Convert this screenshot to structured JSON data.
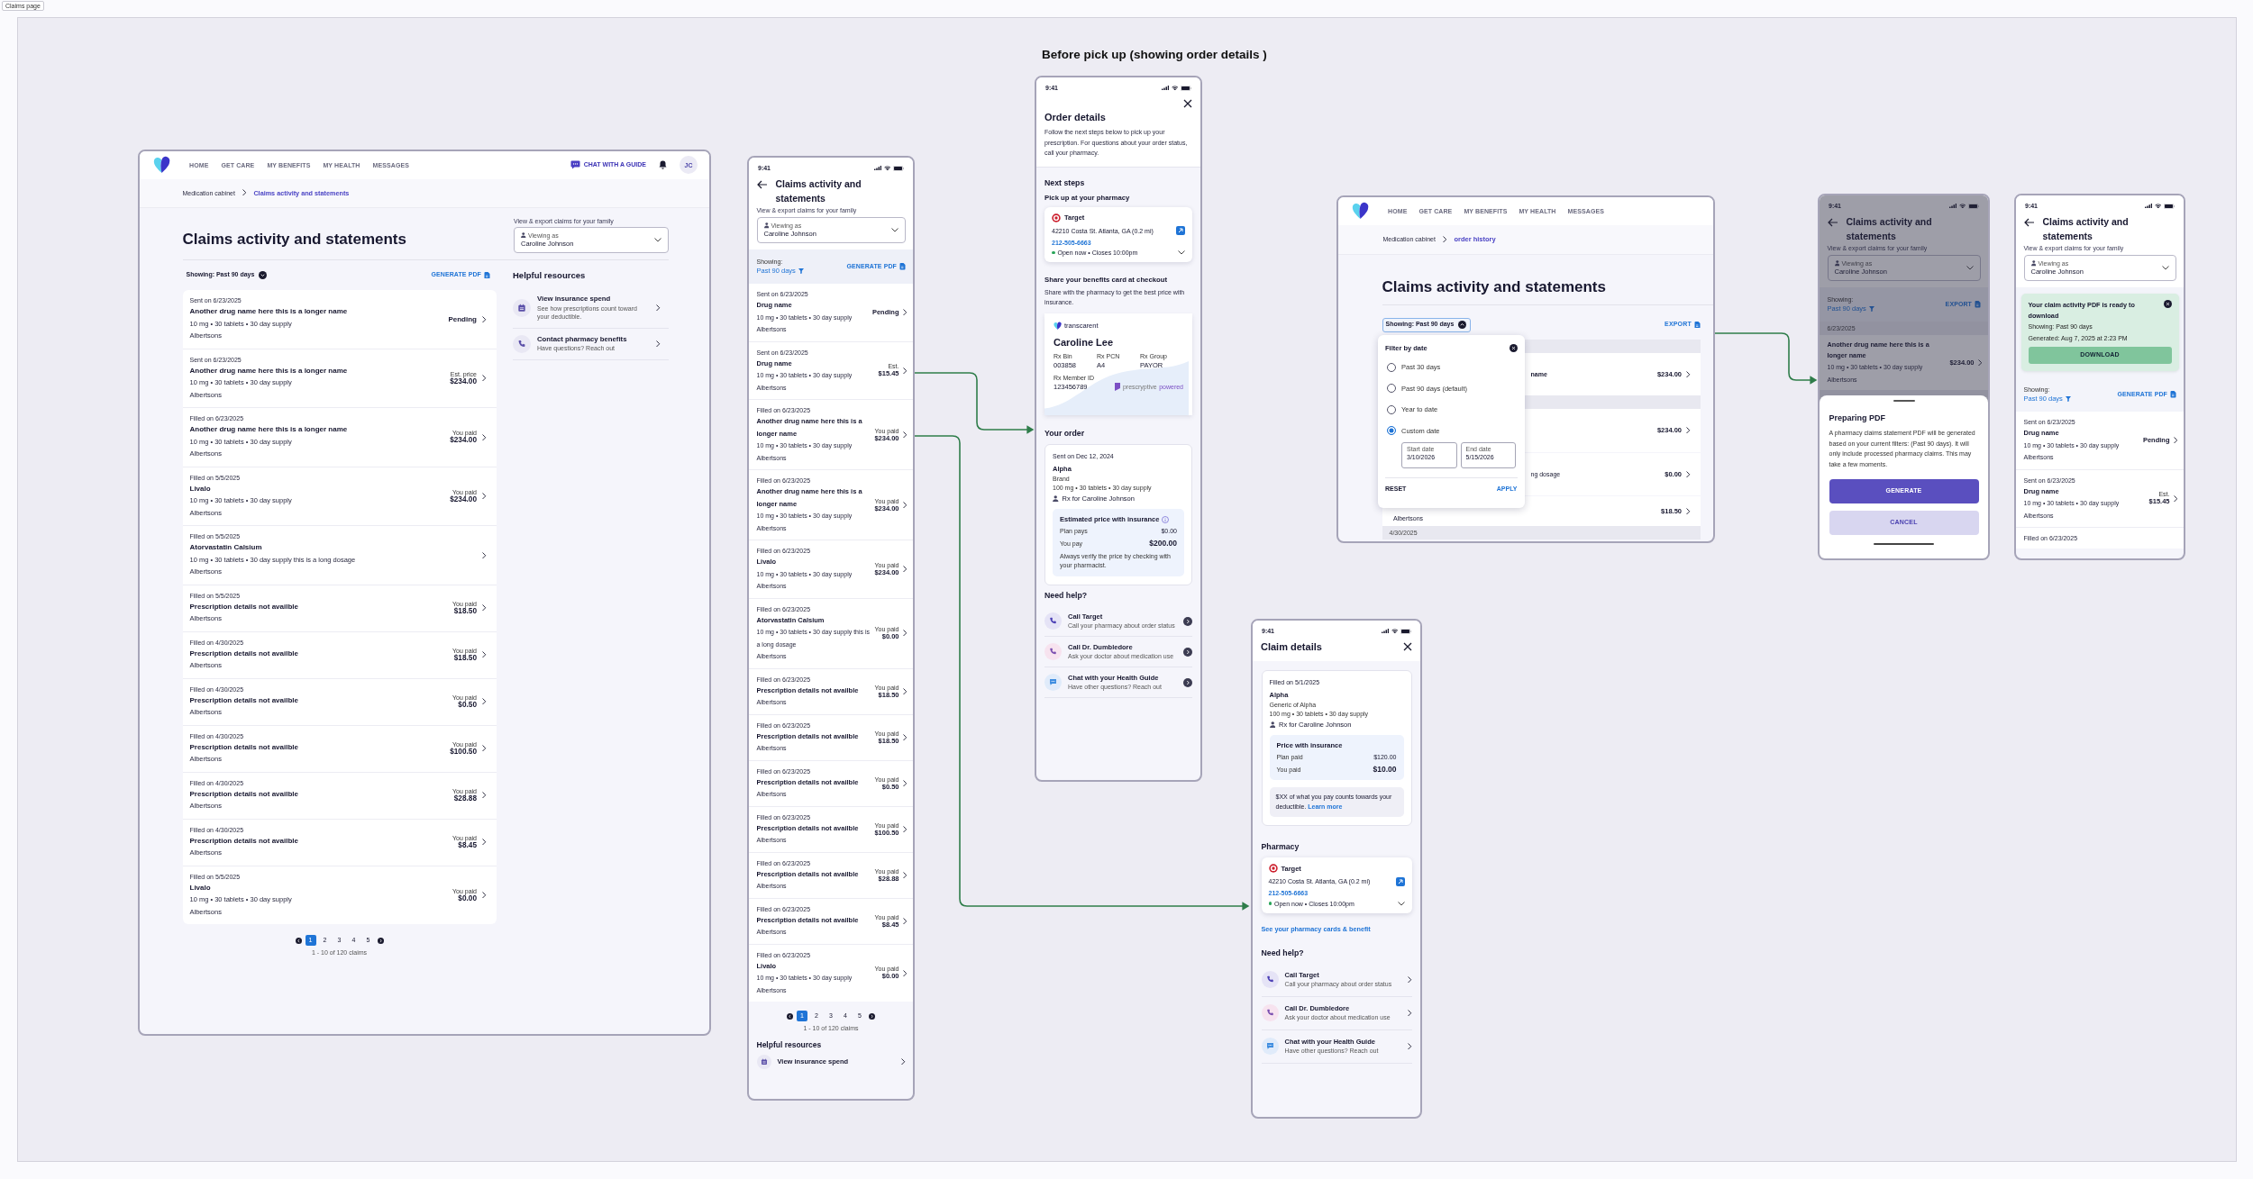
{
  "canvas": {
    "page_tag": "Claims page",
    "section_title": "Before pick up (showing order details )"
  },
  "desktop_claims": {
    "nav": {
      "items": [
        "HOME",
        "GET CARE",
        "MY BENEFITS",
        "MY HEALTH",
        "MESSAGES"
      ],
      "chat": "CHAT WITH A GUIDE",
      "avatar": "JC"
    },
    "breadcrumb": [
      "Medication cabinet",
      "Claims activity and statements"
    ],
    "title": "Claims activity and statements",
    "family_label": "View & export claims for your family",
    "viewer": {
      "label": "Viewing as",
      "name": "Caroline Johnson"
    },
    "filter": {
      "label": "Showing: Past 90 days"
    },
    "generate": "GENERATE PDF",
    "claims": [
      {
        "date": "Sent on 6/23/2025",
        "name": "Another drug name here this is a longer name",
        "detail": "10 mg • 30 tablets • 30 day supply",
        "pharmacy": "Albertsons",
        "status": "Pending"
      },
      {
        "date": "Sent on 6/23/2025",
        "name": "Another drug name here this is a longer name",
        "detail": "10 mg • 30 tablets • 30 day supply",
        "pharmacy": "Albertsons",
        "price_label": "Est. price",
        "amount": "$234.00"
      },
      {
        "date": "Filled on 6/23/2025",
        "name": "Another drug name here this is a longer name",
        "detail": "10 mg • 30 tablets • 30 day supply",
        "pharmacy": "Albertsons",
        "price_label": "You paid",
        "amount": "$234.00"
      },
      {
        "date": "Filled on 5/5/2025",
        "name": "Livalo",
        "detail": "10 mg • 30 tablets • 30 day supply",
        "pharmacy": "Albertsons",
        "price_label": "You paid",
        "amount": "$234.00"
      },
      {
        "date": "Filled on 5/5/2025",
        "name": "Atorvastatin Calsium",
        "detail": "10 mg • 30 tablets • 30 day supply this is a long dosage",
        "pharmacy": "Albertsons"
      },
      {
        "date": "Filled on 5/5/2025",
        "name": "Prescription details not availble",
        "pharmacy": "Albertsons",
        "price_label": "You paid",
        "amount": "$18.50"
      },
      {
        "date": "Filled on 4/30/2025",
        "name": "Prescription details not availble",
        "pharmacy": "Albertsons",
        "price_label": "You paid",
        "amount": "$18.50"
      },
      {
        "date": "Filled on 4/30/2025",
        "name": "Prescription details not availble",
        "pharmacy": "Albertsons",
        "price_label": "You paid",
        "amount": "$0.50"
      },
      {
        "date": "Filled on 4/30/2025",
        "name": "Prescription details not availble",
        "pharmacy": "Albertsons",
        "price_label": "You paid",
        "amount": "$100.50"
      },
      {
        "date": "Filled on 4/30/2025",
        "name": "Prescription details not availble",
        "pharmacy": "Albertsons",
        "price_label": "You paid",
        "amount": "$28.88"
      },
      {
        "date": "Filled on 4/30/2025",
        "name": "Prescription details not availble",
        "pharmacy": "Albertsons",
        "price_label": "You paid",
        "amount": "$8.45"
      },
      {
        "date": "Filled on 5/5/2025",
        "name": "Livalo",
        "detail": "10 mg • 30 tablets • 30 day supply",
        "pharmacy": "Albertsons",
        "price_label": "You paid",
        "amount": "$0.00"
      }
    ],
    "pagination": {
      "pages": [
        {
          "label": "1",
          "selected": true
        },
        {
          "label": "2",
          "selected": false
        },
        {
          "label": "3",
          "selected": false
        },
        {
          "label": "4",
          "selected": false
        },
        {
          "label": "5",
          "selected": false
        }
      ],
      "summary": "1 - 10 of 120 claims"
    },
    "resources": {
      "title": "Helpful resources",
      "items": [
        {
          "kind": "calendar",
          "title": "View insurance spend",
          "subtitle": "See how prescriptions count toward your deductible."
        },
        {
          "kind": "phone",
          "title": "Contact pharmacy benefits",
          "subtitle": "Have questions? Reach out"
        }
      ]
    }
  },
  "mobile_claims": {
    "time": "9:41",
    "title": "Claims activity and statements",
    "family_label": "View & export claims for your family",
    "viewer": {
      "label": "Viewing as",
      "name": "Caroline Johnson"
    },
    "showing_label": "Showing:",
    "filter_value": "Past 90 days",
    "generate": "GENERATE PDF",
    "claims": [
      {
        "date": "Sent on 6/23/2025",
        "name": "Drug name",
        "detail": "10 mg • 30 tablets • 30 day supply",
        "pharmacy": "Albertsons",
        "status": "Pending"
      },
      {
        "date": "Sent on 6/23/2025",
        "name": "Drug name",
        "detail": "10 mg • 30 tablets • 30 day supply",
        "pharmacy": "Albertsons",
        "price_label": "Est.",
        "amount": "$15.45"
      },
      {
        "date": "Filled on 6/23/2025",
        "name": "Another drug name here this is a longer name",
        "detail": "10 mg • 30 tablets • 30 day supply",
        "pharmacy": "Albertsons",
        "price_label": "You paid",
        "amount": "$234.00"
      },
      {
        "date": "Filled on 6/23/2025",
        "name": "Another drug name here this is a longer name",
        "detail": "10 mg • 30 tablets • 30 day supply",
        "pharmacy": "Albertsons",
        "price_label": "You paid",
        "amount": "$234.00"
      },
      {
        "date": "Filled on 6/23/2025",
        "name": "Livalo",
        "detail": "10 mg • 30 tablets • 30 day supply",
        "pharmacy": "Albertsons",
        "price_label": "You paid",
        "amount": "$234.00"
      },
      {
        "date": "Filled on 6/23/2025",
        "name": "Atorvastatin Calsium",
        "detail": "10 mg • 30 tablets • 30 day supply this is a long dosage",
        "pharmacy": "Albertsons",
        "price_label": "You paid",
        "amount": "$0.00"
      },
      {
        "date": "Filled on 6/23/2025",
        "name": "Prescription details not availble",
        "pharmacy": "Albertsons",
        "price_label": "You paid",
        "amount": "$18.50"
      },
      {
        "date": "Filled on 6/23/2025",
        "name": "Prescription details not availble",
        "pharmacy": "Albertsons",
        "price_label": "You paid",
        "amount": "$18.50"
      },
      {
        "date": "Filled on 6/23/2025",
        "name": "Prescription details not availble",
        "pharmacy": "Albertsons",
        "price_label": "You paid",
        "amount": "$0.50"
      },
      {
        "date": "Filled on 6/23/2025",
        "name": "Prescription details not availble",
        "pharmacy": "Albertsons",
        "price_label": "You paid",
        "amount": "$100.50"
      },
      {
        "date": "Filled on 6/23/2025",
        "name": "Prescription details not availble",
        "pharmacy": "Albertsons",
        "price_label": "You paid",
        "amount": "$28.88"
      },
      {
        "date": "Filled on 6/23/2025",
        "name": "Prescription details not availble",
        "pharmacy": "Albertsons",
        "price_label": "You paid",
        "amount": "$8.45"
      },
      {
        "date": "Filled on 6/23/2025",
        "name": "Livalo",
        "detail": "10 mg • 30 tablets • 30 day supply",
        "pharmacy": "Albertsons",
        "price_label": "You paid",
        "amount": "$0.00"
      }
    ],
    "pagination": {
      "pages": [
        {
          "label": "1",
          "selected": true
        },
        {
          "label": "2",
          "selected": false
        },
        {
          "label": "3",
          "selected": false
        },
        {
          "label": "4",
          "selected": false
        },
        {
          "label": "5",
          "selected": false
        }
      ],
      "summary": "1 - 10 of 120 claims"
    },
    "resources": {
      "title": "Helpful resources",
      "items": [
        {
          "kind": "calendar",
          "title": "View insurance spend"
        }
      ]
    }
  },
  "order_details": {
    "time": "9:41",
    "title": "Order details",
    "intro": "Follow the next steps below to pick up your prescription. For questions about your order status, call your pharmacy.",
    "next_steps": "Next steps",
    "pickup_heading": "Pick up at your pharmacy",
    "pharmacy": {
      "name": "Target",
      "address": "42210 Costa St. Atlanta, GA (0.2 mi)",
      "phone": "212-505-6663",
      "hours": "Open now • Closes 10:00pm"
    },
    "share_heading": "Share your benefits card at checkout",
    "share_text": "Share with the pharmacy to get the best price with insurance.",
    "card": {
      "brand": "transcarent",
      "member": "Caroline Lee",
      "fields": [
        {
          "label": "Rx Bin",
          "value": "003858"
        },
        {
          "label": "Rx PCN",
          "value": "A4"
        },
        {
          "label": "Rx Group",
          "value": "PAYOR"
        },
        {
          "label": "Rx Member ID",
          "value": "123456789"
        }
      ],
      "powered_by": "prescryptive",
      "powered": "powered"
    },
    "order_heading": "Your order",
    "order": {
      "date": "Sent on Dec 12, 2024",
      "drug": "Alpha",
      "type": "Brand",
      "detail": "100 mg • 30 tablets • 30 day supply",
      "patient": "Rx for Caroline Johnson",
      "price": {
        "title": "Estimated price with insurance",
        "lines": [
          {
            "label": "Plan pays",
            "value": "$0.00",
            "emphasis": false
          },
          {
            "label": "You pay",
            "value": "$200.00",
            "emphasis": true
          }
        ],
        "note": "Always verify the price by checking with your pharmacist."
      }
    },
    "help": {
      "title": "Need help?",
      "items": [
        {
          "kind": "pharmacy-call",
          "title": "Call Target",
          "subtitle": "Call your pharmacy about order status"
        },
        {
          "kind": "doctor-call",
          "title": "Call Dr. Dumbledore",
          "subtitle": "Ask your doctor about medication use"
        },
        {
          "kind": "chat",
          "title": "Chat with your Health Guide",
          "subtitle": "Have other questions? Reach out"
        }
      ]
    }
  },
  "claim_details": {
    "time": "9:41",
    "title": "Claim details",
    "date": "Filled on 5/1/2025",
    "drug": "Alpha",
    "type": "Generic of Alpha",
    "detail": "100 mg • 30 tablets • 30 day supply",
    "patient": "Rx for Caroline Johnson",
    "price": {
      "title": "Price with insurance",
      "lines": [
        {
          "label": "Plan paid",
          "value": "$120.00",
          "emphasis": false
        },
        {
          "label": "You paid",
          "value": "$10.00",
          "emphasis": true
        }
      ]
    },
    "deductible": {
      "text": "$XX of what you pay counts towards your deductible.",
      "link": "Learn more"
    },
    "pharmacy_heading": "Pharmacy",
    "pharmacy": {
      "name": "Target",
      "address": "42210 Costa St. Atlanta, GA (0.2 mi)",
      "phone": "212-505-6663",
      "hours": "Open now • Closes 10:00pm"
    },
    "cards_link": "See your pharmacy cards & benefit",
    "help": {
      "title": "Need help?",
      "items": [
        {
          "kind": "pharmacy-call",
          "title": "Call Target",
          "subtitle": "Call your pharmacy about order status"
        },
        {
          "kind": "doctor-call",
          "title": "Call Dr. Dumbledore",
          "subtitle": "Ask your doctor about medication use"
        },
        {
          "kind": "chat",
          "title": "Chat with your Health Guide",
          "subtitle": "Have other questions? Reach out"
        }
      ]
    }
  },
  "desktop_filter": {
    "nav": {
      "items": [
        "HOME",
        "GET CARE",
        "MY BENEFITS",
        "MY HEALTH",
        "MESSAGES"
      ]
    },
    "breadcrumb": [
      "Medication cabinet",
      "order history"
    ],
    "title": "Claims activity and statements",
    "filter": {
      "label": "Showing: Past 90 days",
      "expanded": true
    },
    "export": "EXPORT",
    "rows": [
      {
        "kind": "band"
      },
      {
        "kind": "claim",
        "fragment": "name",
        "amount": "$234.00"
      },
      {
        "kind": "band"
      },
      {
        "kind": "claim",
        "amount": "$234.00"
      },
      {
        "kind": "claim",
        "fragment": "ng dosage",
        "amount": "$0.00"
      },
      {
        "kind": "claim",
        "pharmacy": "Albertsons",
        "amount": "$18.50"
      },
      {
        "kind": "band",
        "date": "4/30/2025"
      }
    ],
    "popover": {
      "title": "Filter by date",
      "options": [
        {
          "label": "Past 30 days",
          "selected": false
        },
        {
          "label": "Past 90 days (default)",
          "selected": false
        },
        {
          "label": "Year to date",
          "selected": false
        },
        {
          "label": "Custom date",
          "selected": true
        }
      ],
      "start": {
        "label": "Start date",
        "value": "3/10/2026"
      },
      "end": {
        "label": "End date",
        "value": "5/15/2026"
      },
      "reset": "RESET",
      "apply": "APPLY"
    }
  },
  "preparing_pdf": {
    "time": "9:41",
    "title": "Claims activity and statements",
    "family_label": "View & export claims for your family",
    "viewer": {
      "label": "Viewing as",
      "name": "Caroline Johnson"
    },
    "showing_label": "Showing:",
    "filter_value": "Past 90 days",
    "export": "EXPORT",
    "band_date": "6/23/2025",
    "claim": {
      "name": "Another drug name here this is a longer name",
      "detail": "10 mg • 30 tablets • 30 day supply",
      "pharmacy": "Albertsons",
      "amount": "$234.00"
    },
    "sheet": {
      "title": "Preparing PDF",
      "text": "A pharmacy claims statement PDF will be generated based on your current filters: (Past 90 days). It will only include processed pharmacy claims. This may take a few moments.",
      "primary": "GENERATE",
      "secondary": "CANCEL"
    }
  },
  "pdf_ready": {
    "time": "9:41",
    "title": "Claims activity and statements",
    "family_label": "View & export claims for your family",
    "viewer": {
      "label": "Viewing as",
      "name": "Caroline Johnson"
    },
    "banner": {
      "title": "Your claim activity PDF is ready to download",
      "showing": "Showing: Past 90 days",
      "generated": "Generated: Aug 7, 2025 at 2:23 PM",
      "action": "DOWNLOAD"
    },
    "showing_label": "Showing:",
    "filter_value": "Past 90 days",
    "generate": "GENERATE PDF",
    "claims": [
      {
        "date": "Sent on 6/23/2025",
        "name": "Drug name",
        "detail": "10 mg • 30 tablets • 30 day supply",
        "pharmacy": "Albertsons",
        "status": "Pending"
      },
      {
        "date": "Sent on 6/23/2025",
        "name": "Drug name",
        "detail": "10 mg • 30 tablets • 30 day supply",
        "pharmacy": "Albertsons",
        "price_label": "Est.",
        "amount": "$15.45"
      },
      {
        "date": "Filled on 6/23/2025"
      }
    ]
  }
}
